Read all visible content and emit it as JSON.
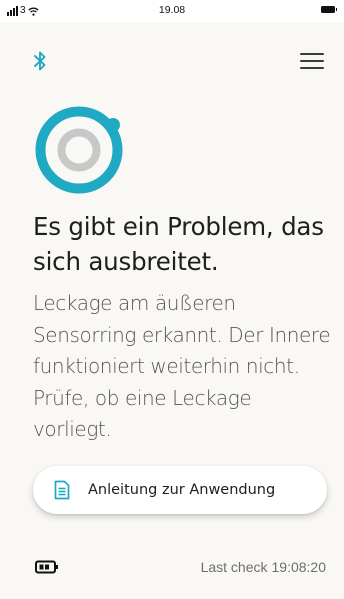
{
  "status_bar": {
    "carrier": "3",
    "time": "19.08",
    "icons": [
      "signal-icon",
      "wifi-icon",
      "battery-icon"
    ]
  },
  "top_bar": {
    "icons": [
      "bluetooth-icon",
      "menu-icon"
    ]
  },
  "sensor": {
    "icon": "sensor-ring-icon",
    "ring_color": "#20a9c2",
    "inner_color": "#c8c8c8"
  },
  "alert": {
    "headline": "Es gibt ein Problem, das sich ausbreitet.",
    "message": "Leckage am äußeren Sensorring erkannt. Der Innere funktioniert weiterhin nicht. Prüfe, ob eine Leckage vorliegt."
  },
  "guide_button": {
    "label": "Anleitung zur Anwendung",
    "icon": "document-icon"
  },
  "footer": {
    "battery_icon": "device-battery-icon",
    "last_check_label": "Last check",
    "last_check_time": "19:08:20"
  },
  "colors": {
    "accent": "#20a9c2",
    "background": "#faf8f5",
    "text_primary": "#1e1e1e",
    "text_secondary": "#555555"
  }
}
